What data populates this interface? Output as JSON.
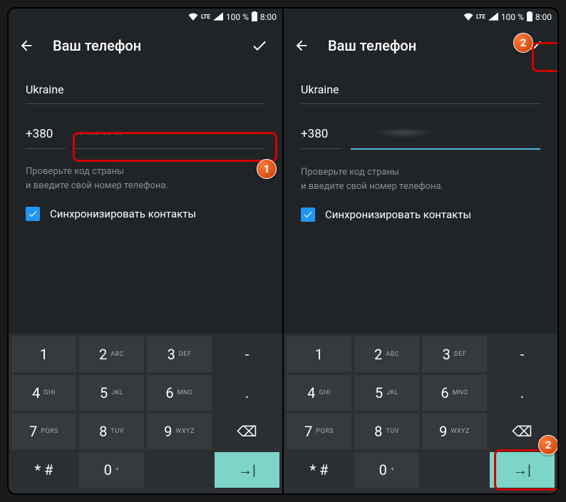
{
  "status": {
    "lte": "LTE",
    "battery": "100 %",
    "time": "8:00"
  },
  "header": {
    "title": "Ваш телефон"
  },
  "form": {
    "country": "Ukraine",
    "prefix": "+380",
    "placeholder": "-- --- -- --",
    "hint1": "Проверьте код страны",
    "hint2": "и введите свой номер телефона.",
    "sync_label": "Синхронизировать контакты"
  },
  "keypad": {
    "rows": [
      [
        {
          "n": "1",
          "s": ""
        },
        {
          "n": "2",
          "s": "ABC"
        },
        {
          "n": "3",
          "s": "DEF"
        },
        {
          "n": "-",
          "s": "",
          "dark": true
        }
      ],
      [
        {
          "n": "4",
          "s": "GHI"
        },
        {
          "n": "5",
          "s": "JKL"
        },
        {
          "n": "6",
          "s": "MNO"
        },
        {
          "n": ".",
          "s": "",
          "dark": true
        }
      ],
      [
        {
          "n": "7",
          "s": "PQRS"
        },
        {
          "n": "8",
          "s": "TUV"
        },
        {
          "n": "9",
          "s": "WXYZ"
        },
        {
          "n": "⌫",
          "s": "",
          "dark": true
        }
      ],
      [
        {
          "n": "* #",
          "s": "",
          "dark": true
        },
        {
          "n": "0",
          "s": "+"
        },
        {
          "n": "",
          "s": "",
          "dark": true
        },
        {
          "n": "→|",
          "s": "",
          "enter": true
        }
      ]
    ]
  },
  "badges": {
    "one": "1",
    "two": "2"
  }
}
